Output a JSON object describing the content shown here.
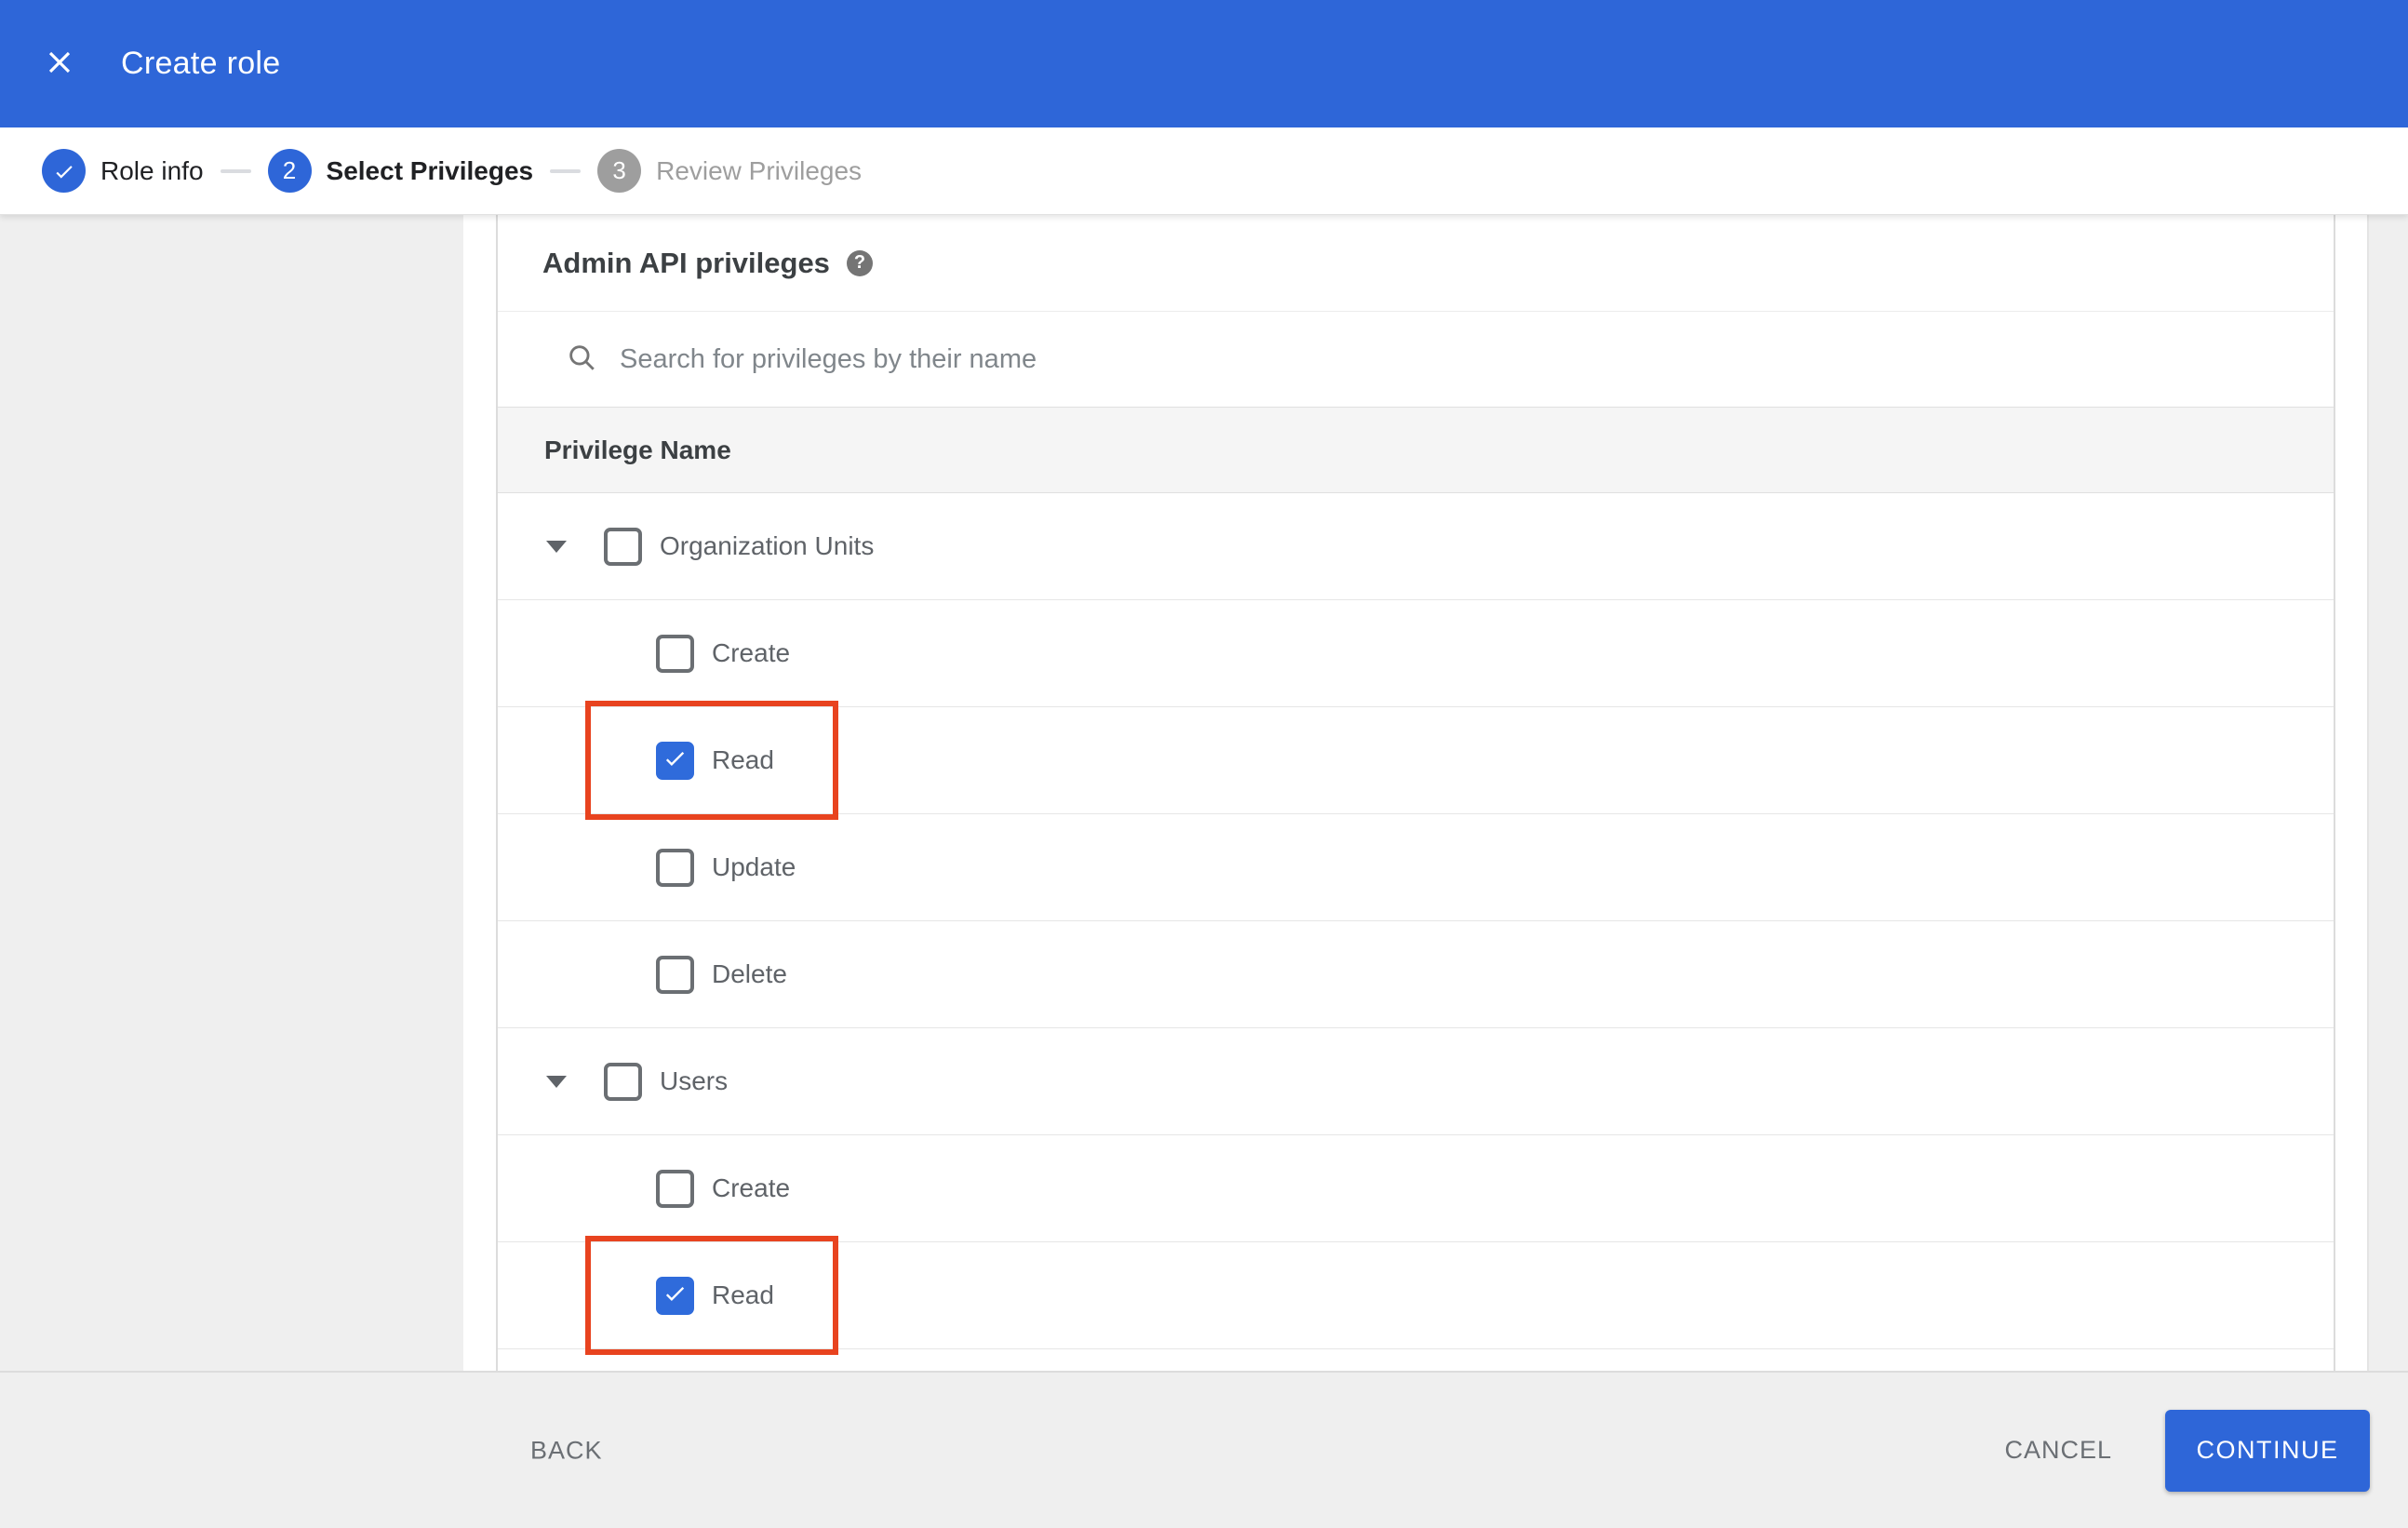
{
  "app_bar": {
    "title": "Create role"
  },
  "stepper": {
    "steps": [
      {
        "label": "Role info",
        "state": "completed"
      },
      {
        "number": "2",
        "label": "Select Privileges",
        "state": "active"
      },
      {
        "number": "3",
        "label": "Review Privileges",
        "state": "upcoming"
      }
    ]
  },
  "privileges": {
    "heading": "Admin API privileges",
    "help_glyph": "?",
    "search_placeholder": "Search for privileges by their name",
    "search_value": "",
    "column_header": "Privilege Name",
    "groups": [
      {
        "label": "Organization Units",
        "checked": false,
        "expanded": true,
        "children": [
          {
            "label": "Create",
            "checked": false,
            "highlighted": false
          },
          {
            "label": "Read",
            "checked": true,
            "highlighted": true
          },
          {
            "label": "Update",
            "checked": false,
            "highlighted": false
          },
          {
            "label": "Delete",
            "checked": false,
            "highlighted": false
          }
        ]
      },
      {
        "label": "Users",
        "checked": false,
        "expanded": true,
        "children": [
          {
            "label": "Create",
            "checked": false,
            "highlighted": false
          },
          {
            "label": "Read",
            "checked": true,
            "highlighted": true
          }
        ]
      }
    ]
  },
  "footer": {
    "back_label": "BACK",
    "cancel_label": "CANCEL",
    "continue_label": "CONTINUE"
  },
  "colors": {
    "accent_blue": "#2e66d8",
    "checkbox_blue": "#2f6bdb",
    "highlight_red": "#e8431f",
    "panel_gray": "#efefef"
  }
}
